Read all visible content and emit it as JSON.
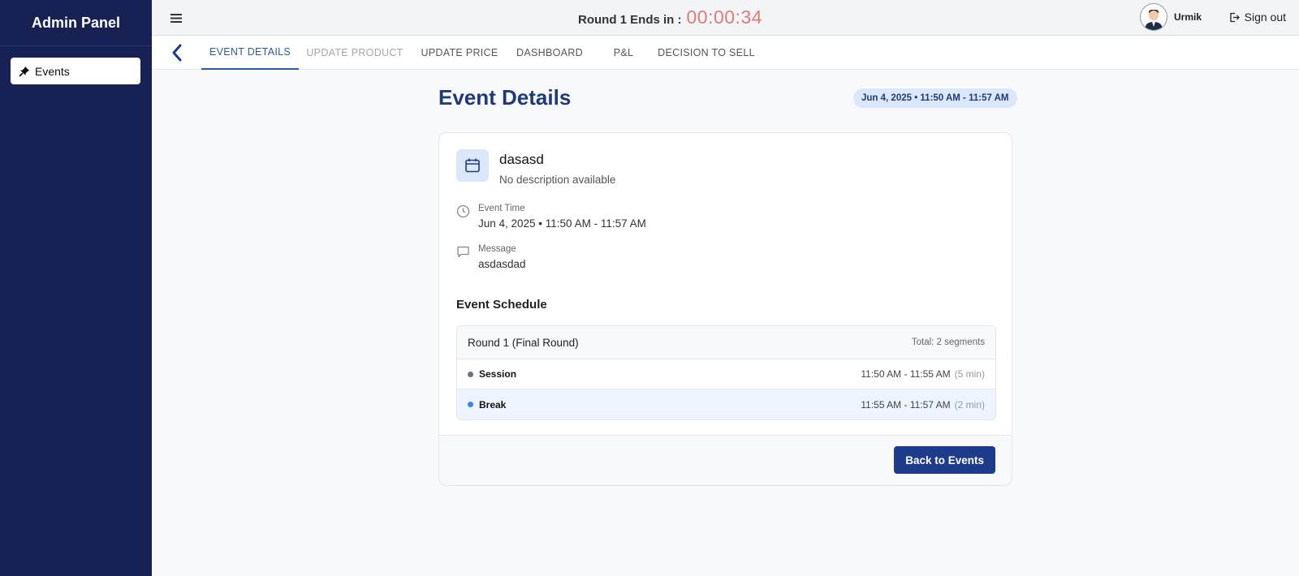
{
  "sidebar": {
    "title": "Admin Panel",
    "items": [
      {
        "label": "Events",
        "icon": "pin-icon"
      }
    ]
  },
  "header": {
    "round_label": "Round 1 Ends in :",
    "round_timer": "00:00:34",
    "user_name": "Urmik",
    "signout_label": "Sign out"
  },
  "tabs": [
    {
      "label": "EVENT DETAILS",
      "state": "active"
    },
    {
      "label": "UPDATE PRODUCT",
      "state": "disabled"
    },
    {
      "label": "UPDATE PRICE",
      "state": "normal"
    },
    {
      "label": "DASHBOARD",
      "state": "normal"
    },
    {
      "label": "P&L",
      "state": "normal"
    },
    {
      "label": "DECISION TO SELL",
      "state": "normal"
    }
  ],
  "page": {
    "title": "Event Details",
    "date_badge": "Jun 4, 2025 • 11:50 AM - 11:57 AM"
  },
  "event": {
    "name": "dasasd",
    "description": "No description available",
    "time_label": "Event Time",
    "time_value": "Jun 4, 2025 • 11:50 AM - 11:57 AM",
    "message_label": "Message",
    "message_value": "asdasdad"
  },
  "schedule": {
    "section_title": "Event Schedule",
    "round_title": "Round 1 (Final Round)",
    "total": "Total: 2 segments",
    "segments": [
      {
        "name": "Session",
        "time": "11:50 AM - 11:55 AM",
        "duration": "(5 min)",
        "dot_color": "#6b7280"
      },
      {
        "name": "Break",
        "time": "11:55 AM - 11:57 AM",
        "duration": "(2 min)",
        "dot_color": "#3b82f6"
      }
    ]
  },
  "footer": {
    "back_label": "Back to Events"
  },
  "colors": {
    "sidebar_bg": "#172153",
    "accent": "#1e3a8a",
    "timer": "#e07a7a",
    "badge_bg": "#dbe8fb"
  }
}
